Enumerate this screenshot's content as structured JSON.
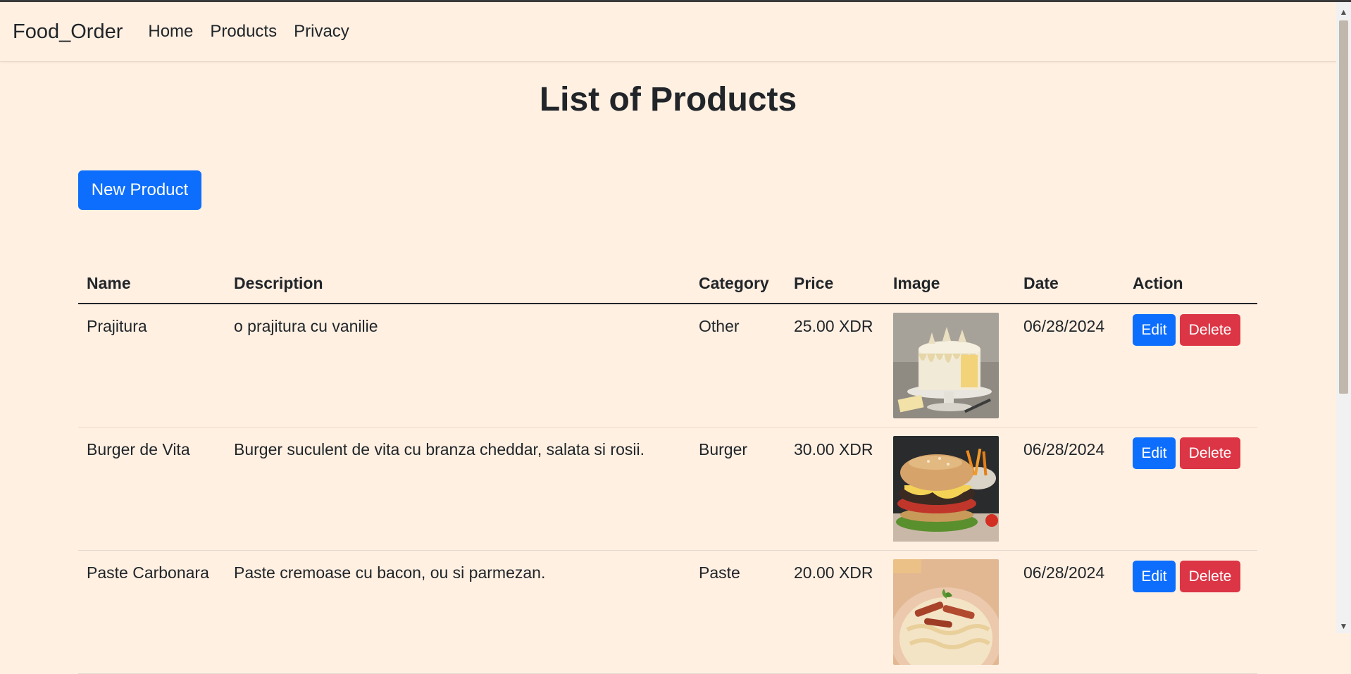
{
  "navbar": {
    "brand": "Food_Order",
    "links": [
      "Home",
      "Products",
      "Privacy"
    ]
  },
  "page": {
    "title": "List of Products",
    "new_button": "New Product"
  },
  "table": {
    "headers": [
      "Name",
      "Description",
      "Category",
      "Price",
      "Image",
      "Date",
      "Action"
    ],
    "rows": [
      {
        "name": "Prajitura",
        "description": "o prajitura cu vanilie",
        "category": "Other",
        "price": "25.00 XDR",
        "image": "cake-photo",
        "date": "06/28/2024",
        "edit": "Edit",
        "delete": "Delete"
      },
      {
        "name": "Burger de Vita",
        "description": "Burger suculent de vita cu branza cheddar, salata si rosii.",
        "category": "Burger",
        "price": "30.00 XDR",
        "image": "burger-photo",
        "date": "06/28/2024",
        "edit": "Edit",
        "delete": "Delete"
      },
      {
        "name": "Paste Carbonara",
        "description": "Paste cremoase cu bacon, ou si parmezan.",
        "category": "Paste",
        "price": "20.00 XDR",
        "image": "pasta-photo",
        "date": "06/28/2024",
        "edit": "Edit",
        "delete": "Delete"
      }
    ]
  },
  "colors": {
    "background": "#fff0e2",
    "primary": "#0d6efd",
    "danger": "#dc3545"
  }
}
